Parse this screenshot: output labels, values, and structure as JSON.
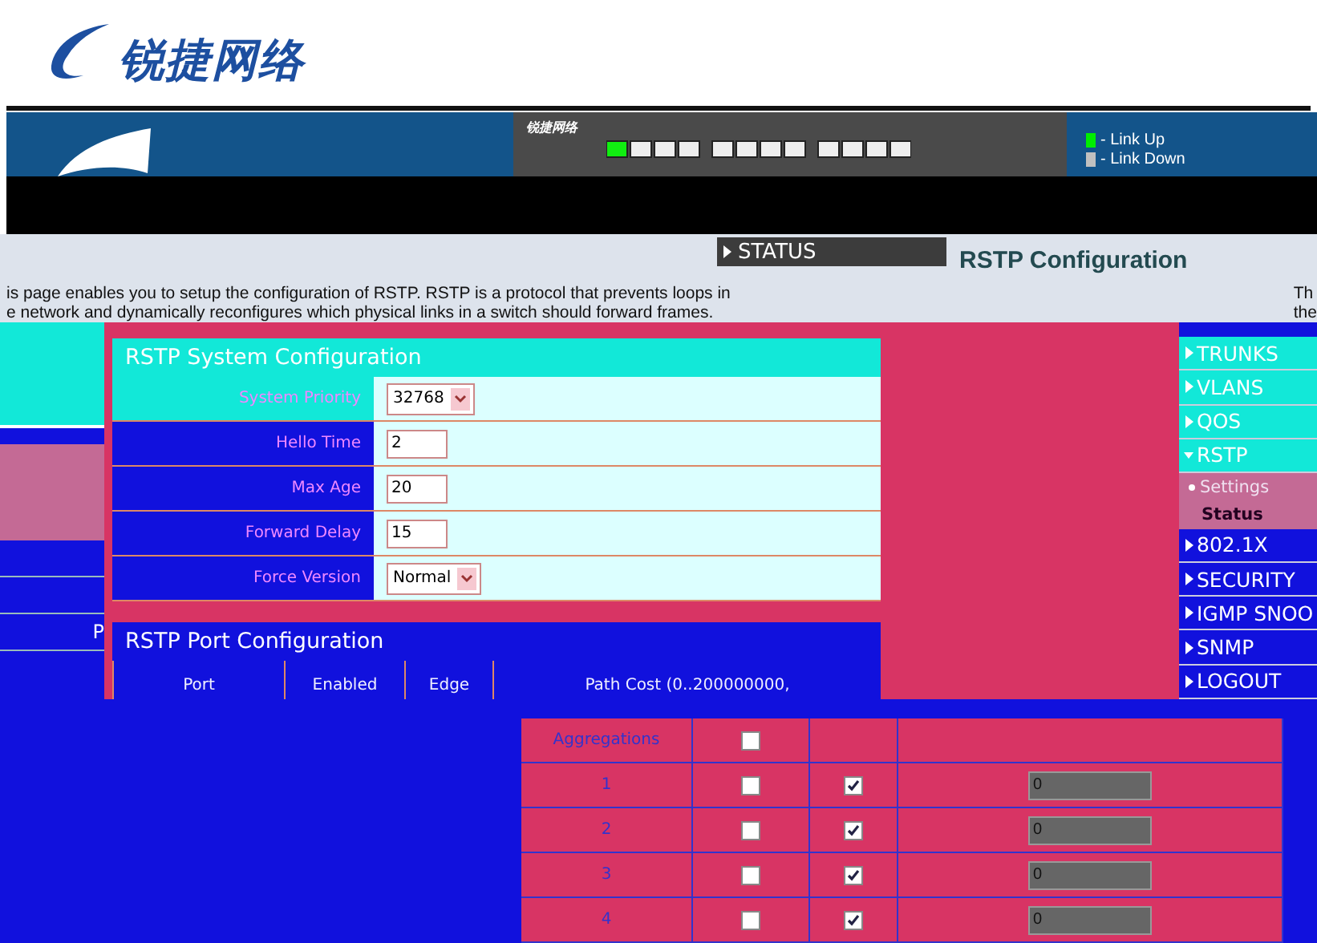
{
  "logo": {
    "text": "锐捷网络"
  },
  "banner": {
    "device_brand": "锐捷网络",
    "legend": [
      {
        "label": "- Link Up",
        "color": "#00ee00"
      },
      {
        "label": "- Link Down",
        "color": "#c0c0c0"
      }
    ]
  },
  "top_menu": {
    "label": "STATUS"
  },
  "page_title": "RSTP Configuration",
  "description": [
    "is page enables you to setup the configuration of RSTP. RSTP is a protocol that prevents loops in",
    "e network and dynamically reconfigures which physical links in a switch should forward frames."
  ],
  "right_description": [
    "Th",
    "the"
  ],
  "left_nav": [
    {
      "label": "P"
    }
  ],
  "system_config": {
    "title": "RSTP System Configuration",
    "fields": [
      {
        "label": "System Priority",
        "kind": "select",
        "value": "32768"
      },
      {
        "label": "Hello Time",
        "kind": "text",
        "value": "2"
      },
      {
        "label": "Max Age",
        "kind": "text",
        "value": "20"
      },
      {
        "label": "Forward Delay",
        "kind": "text",
        "value": "15"
      },
      {
        "label": "Force Version",
        "kind": "select",
        "value": "Normal"
      }
    ]
  },
  "port_config": {
    "title": "RSTP Port Configuration",
    "columns": [
      "Port",
      "Enabled",
      "Edge",
      "Path Cost (0..200000000,"
    ]
  },
  "nav": [
    {
      "label": "TRUNKS",
      "expanded": false
    },
    {
      "label": "VLANS",
      "expanded": false
    },
    {
      "label": "QOS",
      "expanded": false
    },
    {
      "label": "RSTP",
      "expanded": true,
      "children": [
        {
          "label": "Settings",
          "selected": true
        },
        {
          "label": "Status",
          "selected": false
        }
      ]
    },
    {
      "label": "802.1X",
      "expanded": false
    },
    {
      "label": "SECURITY",
      "expanded": false
    },
    {
      "label": "IGMP SNOO",
      "expanded": false
    },
    {
      "label": "SNMP",
      "expanded": false
    },
    {
      "label": "LOGOUT",
      "expanded": false
    }
  ],
  "ports": [
    {
      "port": "Aggregations",
      "enabled": false
    },
    {
      "port": "1",
      "enabled": false,
      "edge": true,
      "path_cost": "0"
    },
    {
      "port": "2",
      "enabled": false,
      "edge": true,
      "path_cost": "0"
    },
    {
      "port": "3",
      "enabled": false,
      "edge": true,
      "path_cost": "0"
    },
    {
      "port": "4",
      "enabled": false,
      "edge": true,
      "path_cost": "0"
    }
  ]
}
